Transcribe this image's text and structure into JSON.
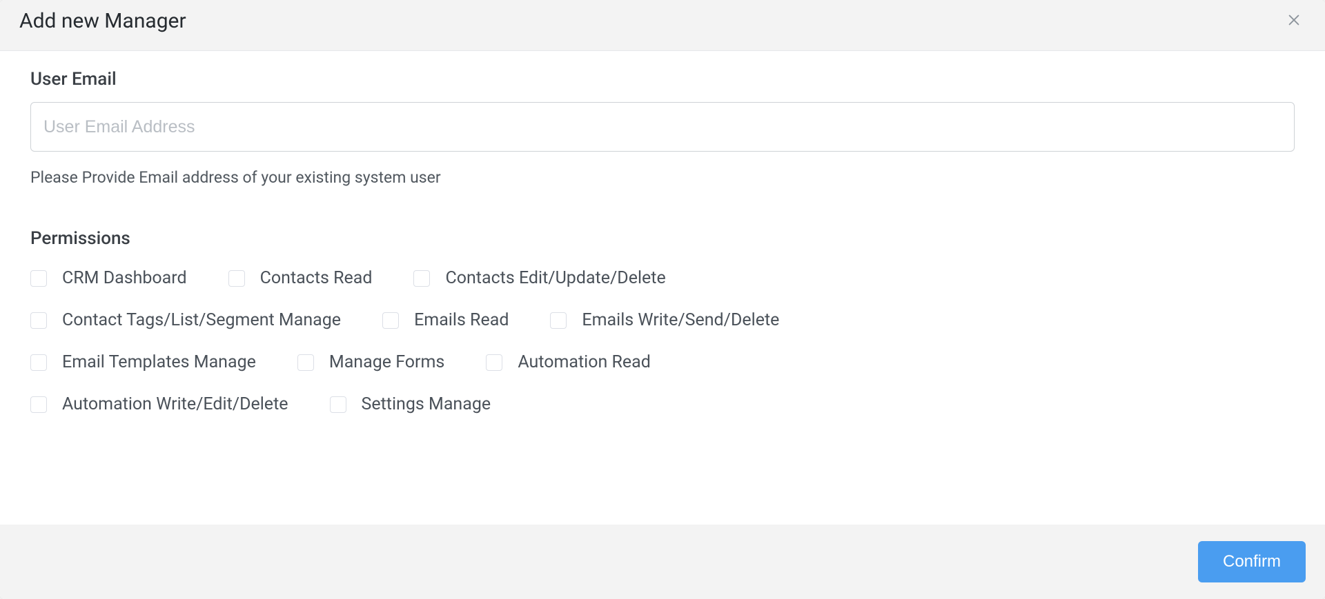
{
  "dialog": {
    "title": "Add new Manager",
    "email_label": "User Email",
    "email_placeholder": "User Email Address",
    "email_value": "",
    "email_help": "Please Provide Email address of your existing system user",
    "permissions_label": "Permissions",
    "confirm_label": "Confirm"
  },
  "permissions": {
    "rows": [
      [
        {
          "key": "crm-dashboard",
          "label": "CRM Dashboard",
          "checked": false
        },
        {
          "key": "contacts-read",
          "label": "Contacts Read",
          "checked": false
        },
        {
          "key": "contacts-edit-update-delete",
          "label": "Contacts Edit/Update/Delete",
          "checked": false
        }
      ],
      [
        {
          "key": "contact-tags-list-segment-manage",
          "label": "Contact Tags/List/Segment Manage",
          "checked": false
        },
        {
          "key": "emails-read",
          "label": "Emails Read",
          "checked": false
        },
        {
          "key": "emails-write-send-delete",
          "label": "Emails Write/Send/Delete",
          "checked": false
        }
      ],
      [
        {
          "key": "email-templates-manage",
          "label": "Email Templates Manage",
          "checked": false
        },
        {
          "key": "manage-forms",
          "label": "Manage Forms",
          "checked": false
        },
        {
          "key": "automation-read",
          "label": "Automation Read",
          "checked": false
        }
      ],
      [
        {
          "key": "automation-write-edit-delete",
          "label": "Automation Write/Edit/Delete",
          "checked": false
        },
        {
          "key": "settings-manage",
          "label": "Settings Manage",
          "checked": false
        }
      ]
    ]
  }
}
